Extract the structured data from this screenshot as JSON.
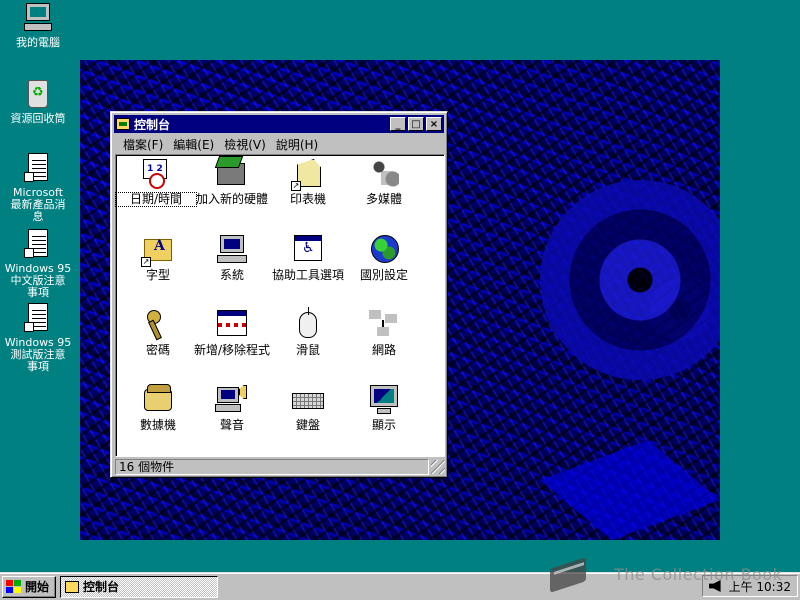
{
  "desktop": {
    "icons": [
      {
        "label": "我的電腦",
        "icon": "my-computer-icon"
      },
      {
        "label": "資源回收筒",
        "icon": "recycle-bin-icon"
      },
      {
        "label": "Microsoft\n最新產品消\n息",
        "icon": "document-shortcut-icon"
      },
      {
        "label": "Windows 95\n中文版注意\n事項",
        "icon": "document-shortcut-icon"
      },
      {
        "label": "Windows 95\n測試版注意\n事項",
        "icon": "document-shortcut-icon"
      }
    ]
  },
  "window": {
    "title": "控制台",
    "buttons": {
      "minimize": "_",
      "maximize": "□",
      "close": "×"
    },
    "menu": [
      "檔案(F)",
      "編輯(E)",
      "檢視(V)",
      "說明(H)"
    ],
    "items": [
      {
        "label": "日期/時間",
        "icon": "date-time-icon"
      },
      {
        "label": "加入新的硬體",
        "icon": "add-hardware-icon"
      },
      {
        "label": "印表機",
        "icon": "printers-icon"
      },
      {
        "label": "多媒體",
        "icon": "multimedia-icon"
      },
      {
        "label": "字型",
        "icon": "fonts-icon"
      },
      {
        "label": "系統",
        "icon": "system-icon"
      },
      {
        "label": "協助工具選項",
        "icon": "accessibility-icon"
      },
      {
        "label": "國別設定",
        "icon": "regional-settings-icon"
      },
      {
        "label": "密碼",
        "icon": "passwords-icon"
      },
      {
        "label": "新增/移除程式",
        "icon": "add-remove-programs-icon"
      },
      {
        "label": "滑鼠",
        "icon": "mouse-icon"
      },
      {
        "label": "網路",
        "icon": "network-icon"
      },
      {
        "label": "數據機",
        "icon": "modems-icon"
      },
      {
        "label": "聲音",
        "icon": "sounds-icon"
      },
      {
        "label": "鍵盤",
        "icon": "keyboard-icon"
      },
      {
        "label": "顯示",
        "icon": "display-icon"
      }
    ],
    "status": "16 個物件"
  },
  "taskbar": {
    "start_label": "開始",
    "tasks": [
      {
        "label": "控制台"
      }
    ],
    "clock": "上午 10:32"
  },
  "watermark": "The Collection Book"
}
